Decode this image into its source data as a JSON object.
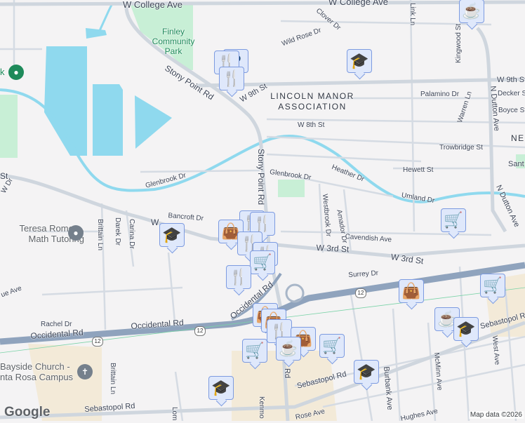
{
  "map": {
    "parks": {
      "finley": "Finley Community Park"
    },
    "areas": {
      "lincoln_manor": "LINCOLN MANOR ASSOCIATION",
      "ne": "NE A",
      "santa": "Sant"
    },
    "places": {
      "tutoring": "Teresa Romero, Math Tutoring",
      "church": "Bayside Church - nta Rosa Campus",
      "park_k": "k"
    },
    "roads": {
      "college": "W College Ave",
      "college2": "W College Ave",
      "stony1": "Stony Point Rd",
      "stony2": "Stony Point Rd",
      "w9th": "W 9th St",
      "w9th2": "W 9th St",
      "clover": "Clover Dr",
      "wildrose": "Wild Rose Dr",
      "link": "Link Ln",
      "kingwood": "Kingwood St",
      "palamino": "Palamino Dr",
      "decker": "Decker St",
      "boyce": "Boyce St",
      "warren": "Warren Ln",
      "ndutton": "N Dutton Ave",
      "ndutton2": "N Dutton Ave",
      "w8th": "W 8th St",
      "trowbridge": "Trowbridge St",
      "hewett": "Hewett St",
      "glenbrook1": "Glenbrook Dr",
      "glenbrook2": "Glenbrook Dr",
      "heather": "Heather Dr",
      "umland": "Umland Dr",
      "westbrook": "Westbrook Dr",
      "amador": "Amador Dr",
      "cavendish": "Cavendish Ave",
      "w3rd1": "W 3rd St",
      "w3rd2": "W 3rd St",
      "w3rd0": "St",
      "w3rdW": "W",
      "bancroft": "Bancroft Dr",
      "surrey": "Surrey Dr",
      "brittain1": "Brittain Ln",
      "brittain2": "Brittain Ln",
      "darek": "Darek Dr",
      "carina": "Carina Dr",
      "ue": "ue Ave",
      "wdr": "W Dr",
      "rachel": "Rachel Dr",
      "occ1": "Occidental Rd",
      "occ2": "Occidental Rd",
      "occ3": "Occidental Rd",
      "seb1": "Sebastopol Rd",
      "seb2": "Sebastopol Rd",
      "seb3": "Sebastopol Rd",
      "burbank": "Burbank Ave",
      "mcminn": "McMinn Ave",
      "westave": "West Ave",
      "lom": "Lom",
      "kenm": "Kenmo",
      "rd": "Rd",
      "rose": "Rose Ave",
      "hughes": "Hughes Ave"
    },
    "route_shields": [
      "12",
      "12",
      "12"
    ],
    "markers": [
      {
        "icon": "parking-icon"
      },
      {
        "icon": "restaurant-icon"
      },
      {
        "icon": "restaurant-icon"
      },
      {
        "icon": "coffee-icon"
      },
      {
        "icon": "school-icon"
      },
      {
        "icon": "shopping-cart-icon"
      },
      {
        "icon": "school-icon"
      },
      {
        "icon": "restaurant-icon"
      },
      {
        "icon": "restaurant-icon"
      },
      {
        "icon": "shopping-bag-icon"
      },
      {
        "icon": "restaurant-icon"
      },
      {
        "icon": "restaurant-icon"
      },
      {
        "icon": "shopping-cart-icon"
      },
      {
        "icon": "restaurant-icon"
      },
      {
        "icon": "shopping-bag-icon"
      },
      {
        "icon": "shopping-cart-icon"
      },
      {
        "icon": "coffee-icon"
      },
      {
        "icon": "school-icon"
      },
      {
        "icon": "shopping-bag-icon"
      },
      {
        "icon": "shopping-bag-icon"
      },
      {
        "icon": "restaurant-icon"
      },
      {
        "icon": "shopping-bag-icon"
      },
      {
        "icon": "shopping-cart-icon"
      },
      {
        "icon": "coffee-icon"
      },
      {
        "icon": "shopping-cart-icon"
      },
      {
        "icon": "school-icon"
      },
      {
        "icon": "school-icon"
      }
    ],
    "colors": {
      "water": "#8fd9ee",
      "park": "#c8efd6",
      "highway": "#8fa3bd",
      "road": "#d5dbe3",
      "marker_bg": "#dfe8fb",
      "marker_icon": "#0b3d66"
    }
  },
  "footer": {
    "logo": "Google",
    "copyright": "Map data ©2026"
  }
}
